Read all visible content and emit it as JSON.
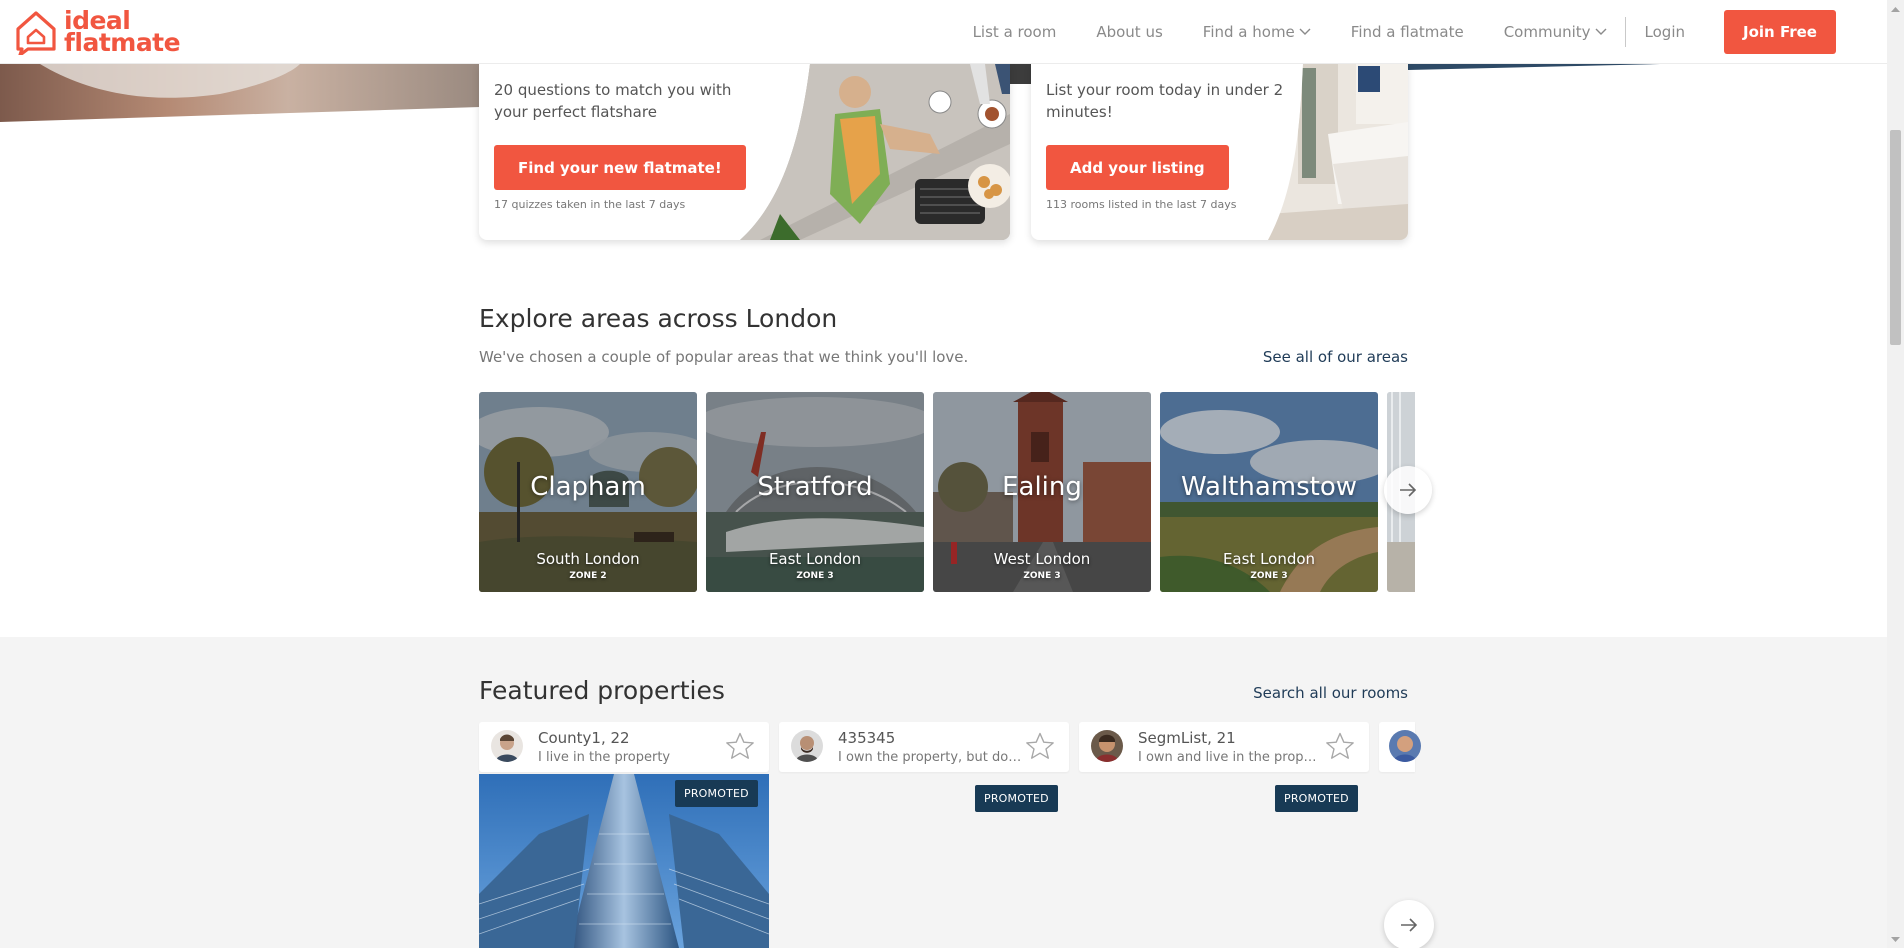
{
  "brand": {
    "name_line1": "ideal",
    "name_line2": "flatmate",
    "accent": "#f15640",
    "navy": "#183a55"
  },
  "nav": {
    "items": [
      {
        "label": "List a room"
      },
      {
        "label": "About us"
      },
      {
        "label": "Find a home"
      },
      {
        "label": "Find a flatmate"
      },
      {
        "label": "Community"
      }
    ],
    "login": "Login",
    "join": "Join Free"
  },
  "promo": {
    "left": {
      "text": "20 questions to match you with your perfect flatshare",
      "button": "Find your new flatmate!",
      "note": "17 quizzes taken in the last 7 days"
    },
    "right": {
      "text": "List your room today in under 2 minutes!",
      "button": "Add your listing",
      "note": "113 rooms listed in the last 7 days"
    }
  },
  "explore": {
    "title": "Explore areas across London",
    "subtitle": "We've chosen a couple of popular areas that we think you'll love.",
    "link": "See all of our areas",
    "areas": [
      {
        "name": "Clapham",
        "region": "South London",
        "zone": "ZONE 2"
      },
      {
        "name": "Stratford",
        "region": "East London",
        "zone": "ZONE 3"
      },
      {
        "name": "Ealing",
        "region": "West London",
        "zone": "ZONE 3"
      },
      {
        "name": "Walthamstow",
        "region": "East London",
        "zone": "ZONE 3"
      }
    ]
  },
  "featured": {
    "title": "Featured properties",
    "link": "Search all our rooms",
    "properties": [
      {
        "name": "County1, 22",
        "desc": "I live in the property",
        "badge": "PROMOTED"
      },
      {
        "name": "435345",
        "desc": "I own the property, but don't live there",
        "badge": "PROMOTED"
      },
      {
        "name": "SegmList, 21",
        "desc": "I own and live in the property",
        "badge": "PROMOTED"
      }
    ]
  }
}
